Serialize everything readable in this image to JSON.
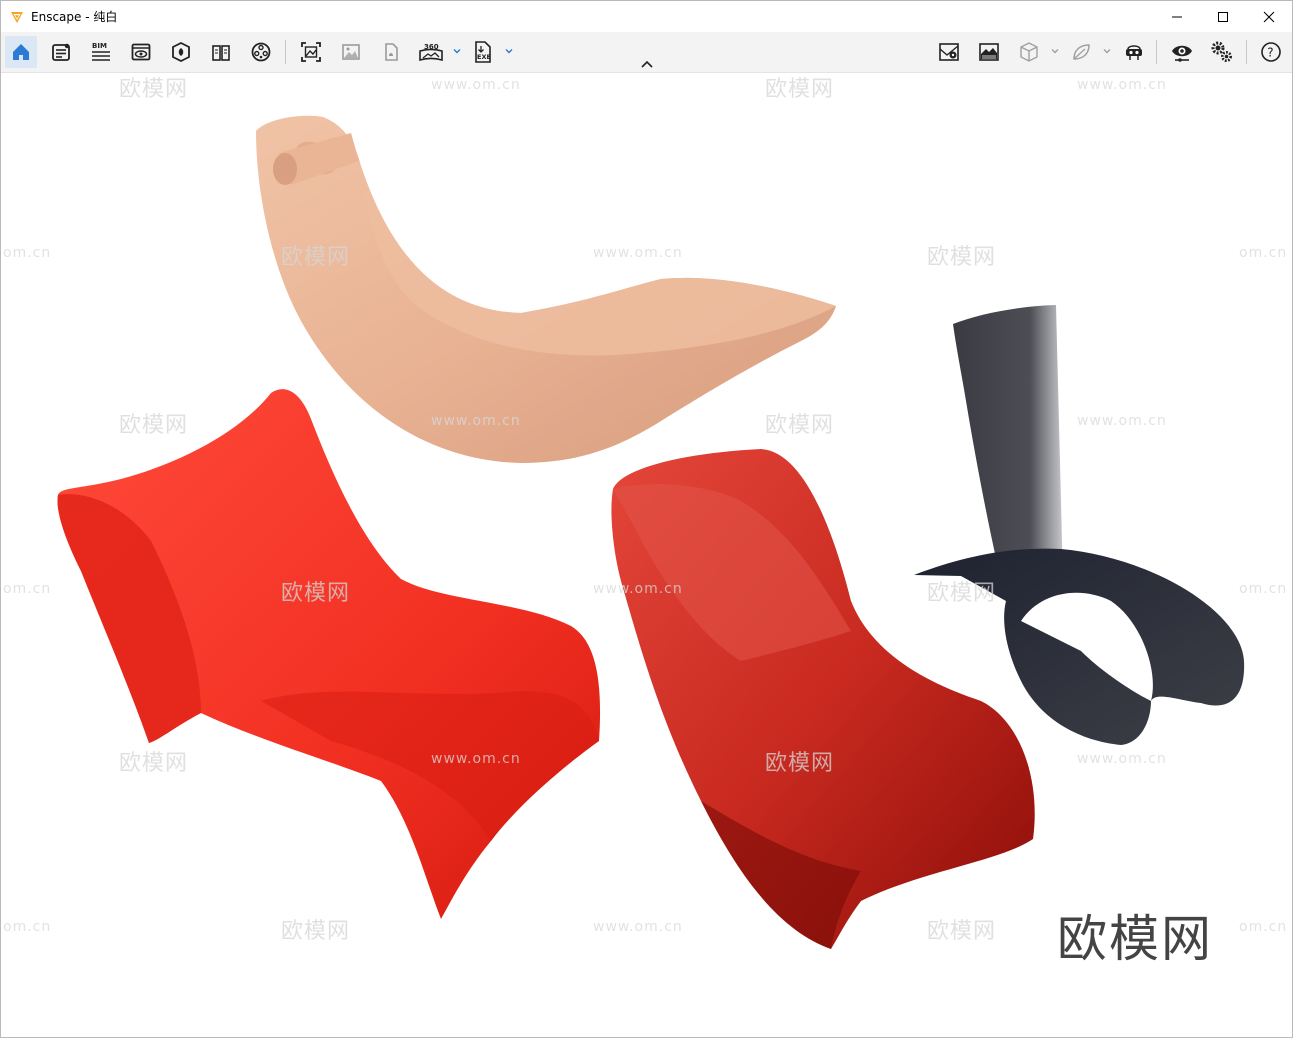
{
  "window": {
    "title": "Enscape - 纯白"
  },
  "toolbar": {
    "left_items": [
      {
        "name": "home-icon"
      },
      {
        "name": "notes-icon"
      },
      {
        "name": "bim-icon",
        "label": "BIM"
      },
      {
        "name": "view-management-icon"
      },
      {
        "name": "asset-library-icon"
      },
      {
        "name": "materials-icon"
      },
      {
        "name": "video-editor-icon"
      },
      {
        "name": "screenshot-icon"
      },
      {
        "name": "batch-render-icon"
      },
      {
        "name": "upload-icon"
      },
      {
        "name": "panorama-360-icon",
        "label": "360"
      },
      {
        "name": "exe-export-icon",
        "label": "EXE"
      }
    ],
    "right_items": [
      {
        "name": "site-context-icon"
      },
      {
        "name": "atmosphere-icon"
      },
      {
        "name": "view-cube-icon"
      },
      {
        "name": "vegetation-icon"
      },
      {
        "name": "vr-headset-icon"
      },
      {
        "name": "visual-settings-icon"
      },
      {
        "name": "settings-icon"
      },
      {
        "name": "help-icon"
      }
    ]
  },
  "watermark": {
    "text": "欧模网",
    "url": "www.om.cn",
    "url_cropped": "om.cn"
  },
  "brand_text": "欧模网"
}
